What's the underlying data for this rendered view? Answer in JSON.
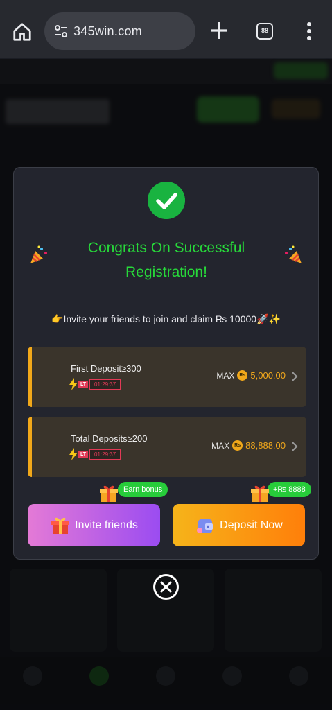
{
  "browser": {
    "url": "345win.com",
    "tab_count": "88"
  },
  "modal": {
    "title": "Congrats On Successful Registration!",
    "invite_message": "👉Invite your friends to join and claim ₨ 10000🚀✨",
    "rewards": [
      {
        "label": "First Deposit≥300",
        "timer_tag": "LT",
        "timer": "01:29:37",
        "max_label": "MAX",
        "currency": "Rs",
        "amount": "5,000.00"
      },
      {
        "label": "Total Deposits≥200",
        "timer_tag": "LT",
        "timer": "01:29:37",
        "max_label": "MAX",
        "currency": "Rs",
        "amount": "88,888.00"
      }
    ],
    "earn_bonus_badge": "Earn bonus",
    "deposit_bonus_badge": "+₨ 8888",
    "invite_button": "Invite friends",
    "deposit_button": "Deposit Now"
  },
  "colors": {
    "accent_green": "#27d93a",
    "gold": "#f3a91c",
    "timer_red": "#e13a56"
  },
  "icons": [
    "home-icon",
    "site-settings-icon",
    "new-tab-icon",
    "tabs-icon",
    "menu-icon",
    "check-icon",
    "party-popper-icon",
    "bolt-icon",
    "rupee-coin-icon",
    "chevron-right-icon",
    "gift-icon",
    "wallet-icon",
    "close-icon"
  ]
}
